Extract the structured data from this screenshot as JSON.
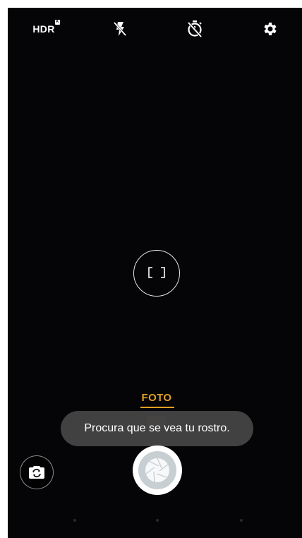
{
  "top_bar": {
    "hdr_label": "HDR",
    "hdr_badge": "A",
    "icons": [
      "hdr-auto-icon",
      "flash-off-icon",
      "timer-off-icon",
      "settings-gear-icon"
    ]
  },
  "mode": {
    "current": "FOTO",
    "accent_color": "#e2a021"
  },
  "toast": {
    "message": "Procura que se vea tu rostro."
  },
  "controls": {
    "icons": [
      "switch-camera-icon",
      "shutter-icon"
    ]
  }
}
